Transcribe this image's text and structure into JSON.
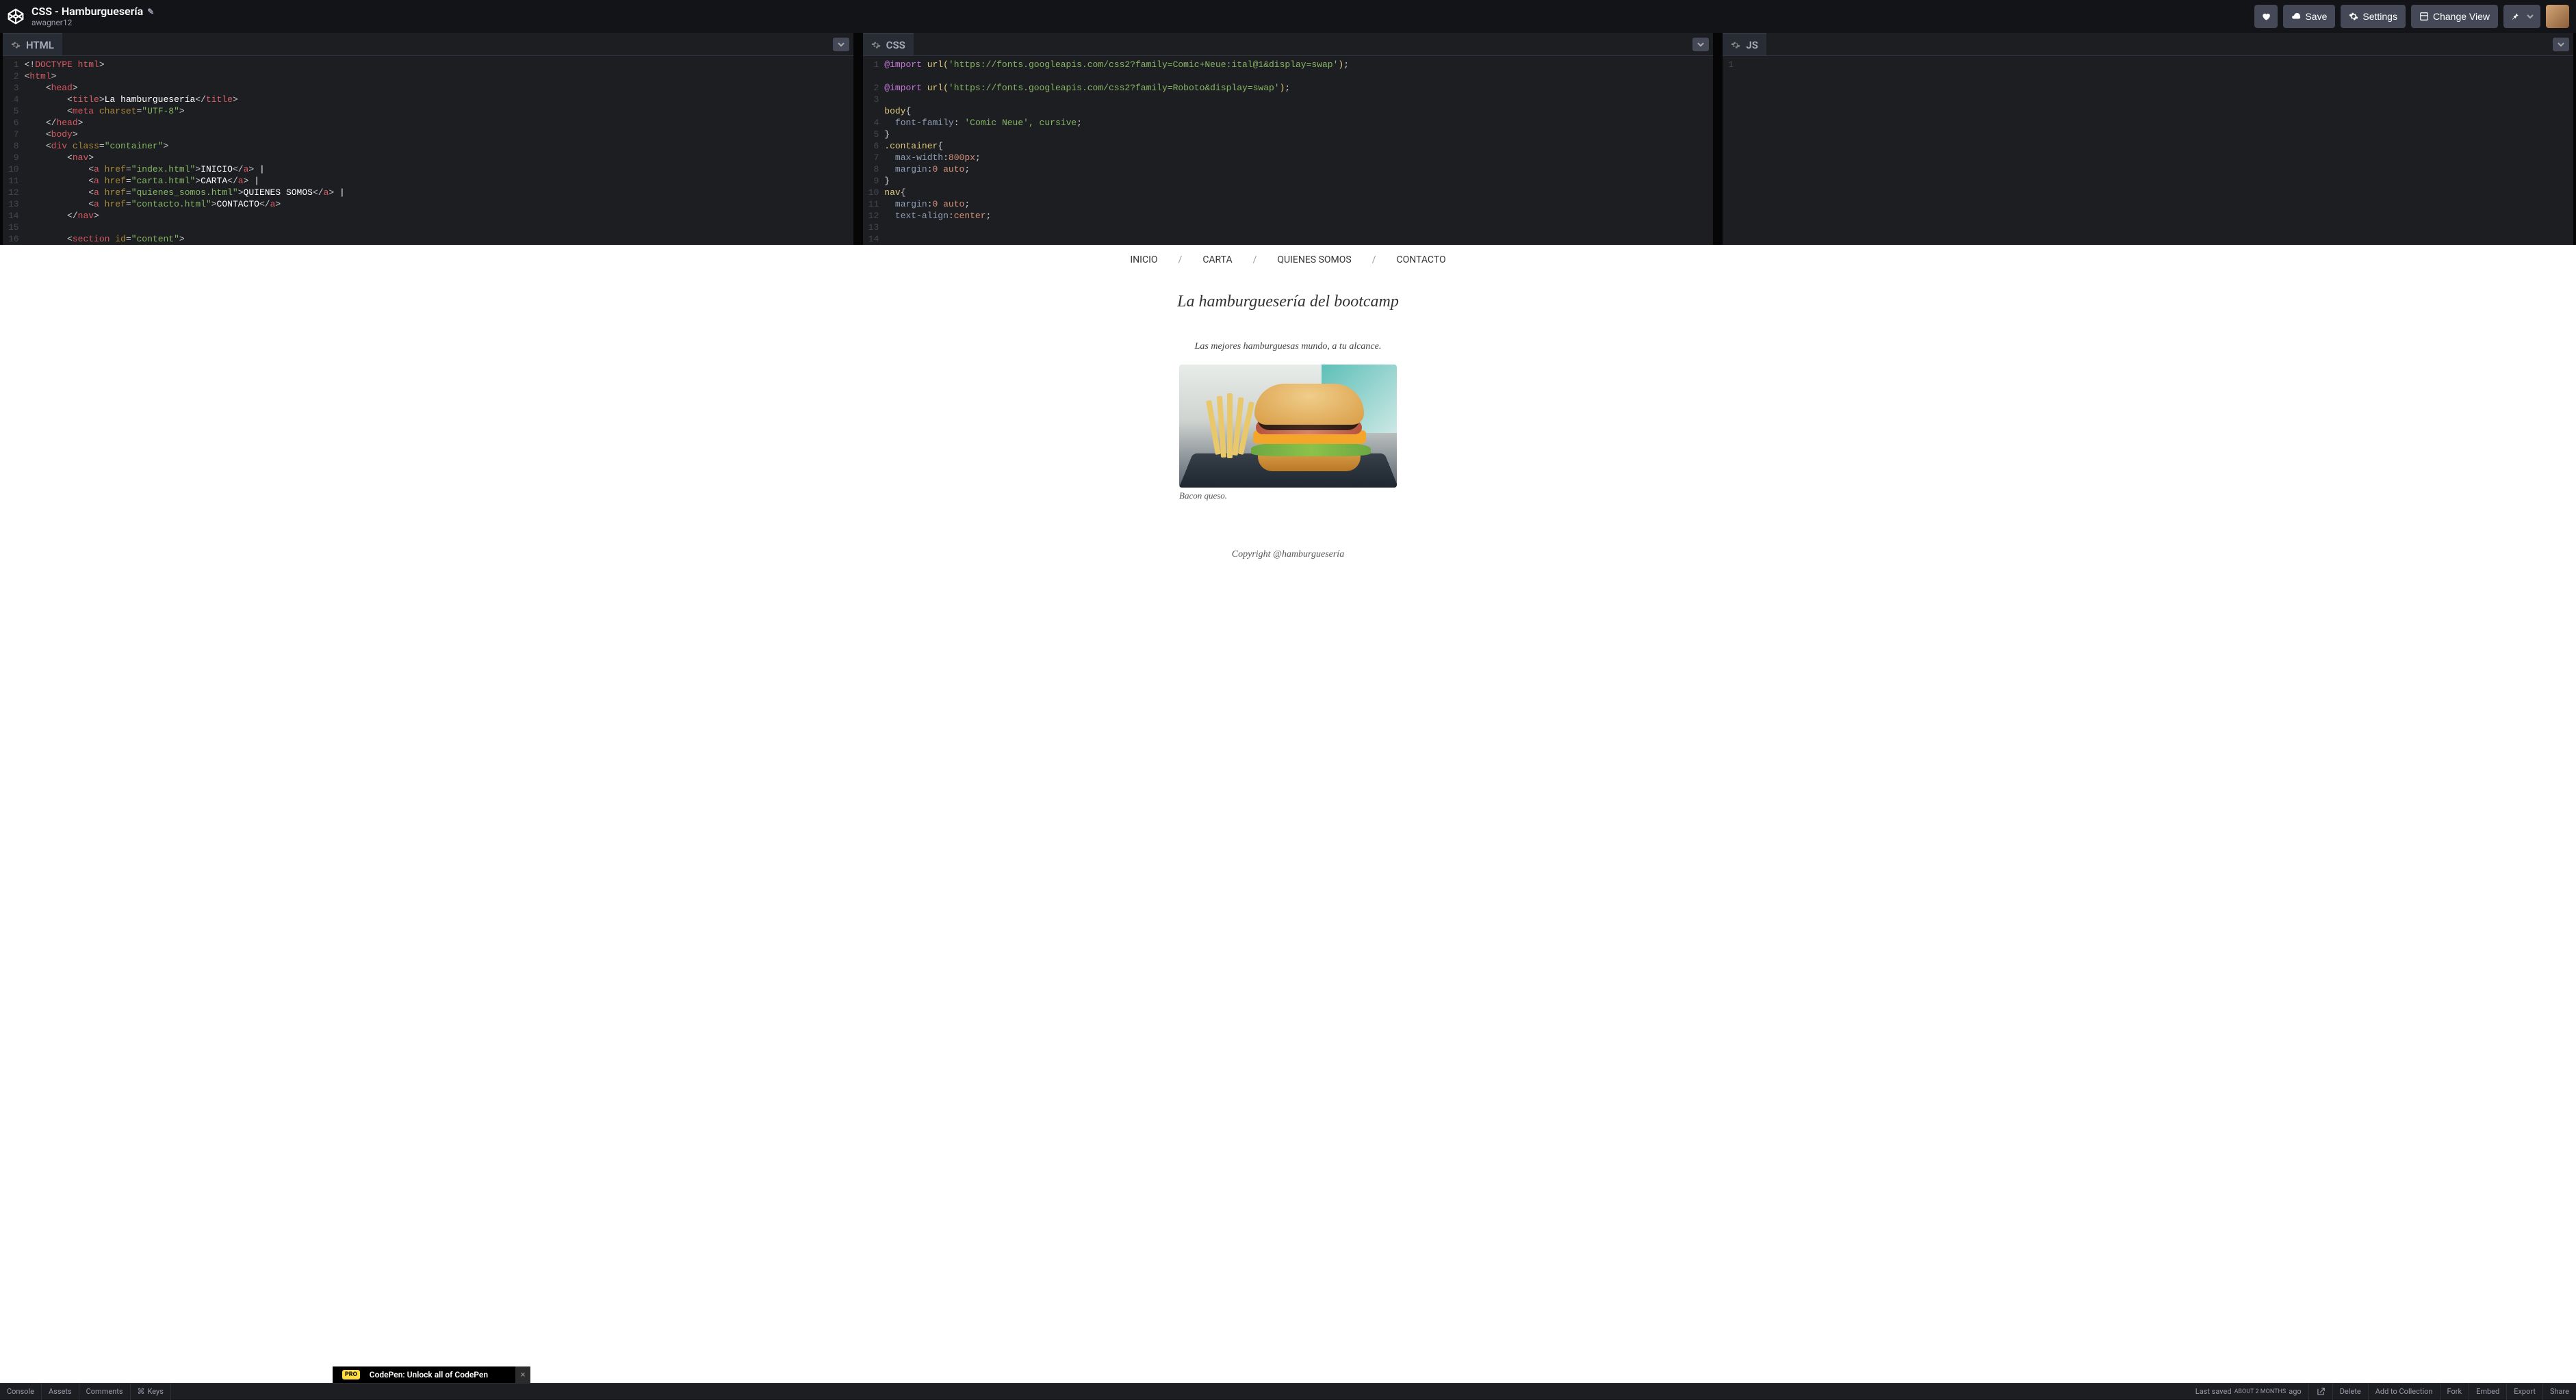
{
  "header": {
    "title": "CSS - Hamburguesería",
    "author": "awagner12",
    "buttons": {
      "save": "Save",
      "settings": "Settings",
      "changeView": "Change View"
    }
  },
  "panels": {
    "html": {
      "label": "HTML"
    },
    "css": {
      "label": "CSS"
    },
    "js": {
      "label": "JS"
    }
  },
  "htmlCode": {
    "lines": [
      "1",
      "2",
      "3",
      "4",
      "5",
      "6",
      "7",
      "8",
      "9",
      "10",
      "11",
      "12",
      "13",
      "14",
      "15",
      "16"
    ]
  },
  "cssCode": {
    "lines": [
      "1",
      "",
      "2",
      "3",
      "",
      "4",
      "5",
      "6",
      "7",
      "8",
      "9",
      "10",
      "11",
      "12",
      "13",
      "14"
    ]
  },
  "jsCode": {
    "lines": [
      "1"
    ]
  },
  "htmlTokens": {
    "doctype": "<!DOCTYPE html>",
    "title_text": "La hamburguesería",
    "charset": "\"UTF-8\"",
    "class_container": "\"container\"",
    "href_index": "\"index.html\"",
    "href_carta": "\"carta.html\"",
    "href_quienes": "\"quienes_somos.html\"",
    "href_contacto": "\"contacto.html\"",
    "inicio": "INICIO",
    "carta": "CARTA",
    "quienes": "QUIENES SOMOS",
    "contacto": "CONTACTO",
    "id_content": "\"content\""
  },
  "cssTokens": {
    "import1": "'https://fonts.googleapis.com/css2?family=Comic+Neue:ital@1&display=swap'",
    "import2": "'https://fonts.googleapis.com/css2?family=Roboto&display=swap'",
    "ff_val": "'Comic Neue', cursive",
    "mw_val": "800px",
    "margin_val": "0 auto",
    "ta_val": "center"
  },
  "preview": {
    "nav": {
      "inicio": "INICIO",
      "carta": "CARTA",
      "quienes": "QUIENES SOMOS",
      "contacto": "CONTACTO",
      "sep": "/"
    },
    "heading": "La hamburguesería del bootcamp",
    "subheading": "Las mejores hamburguesas mundo, a tu alcance.",
    "caption": "Bacon queso.",
    "copyright": "Copyright @hamburguesería"
  },
  "footer": {
    "left": {
      "console": "Console",
      "assets": "Assets",
      "comments": "Comments",
      "keys": "Keys"
    },
    "right": {
      "saved_prefix": "Last saved ",
      "saved_time": "ABOUT 2 MONTHS",
      "saved_suffix": " ago",
      "delete": "Delete",
      "addCollection": "Add to Collection",
      "fork": "Fork",
      "embed": "Embed",
      "export": "Export",
      "share": "Share"
    }
  },
  "popup": {
    "badge": "PRO",
    "text": "CodePen: Unlock all of CodePen"
  }
}
